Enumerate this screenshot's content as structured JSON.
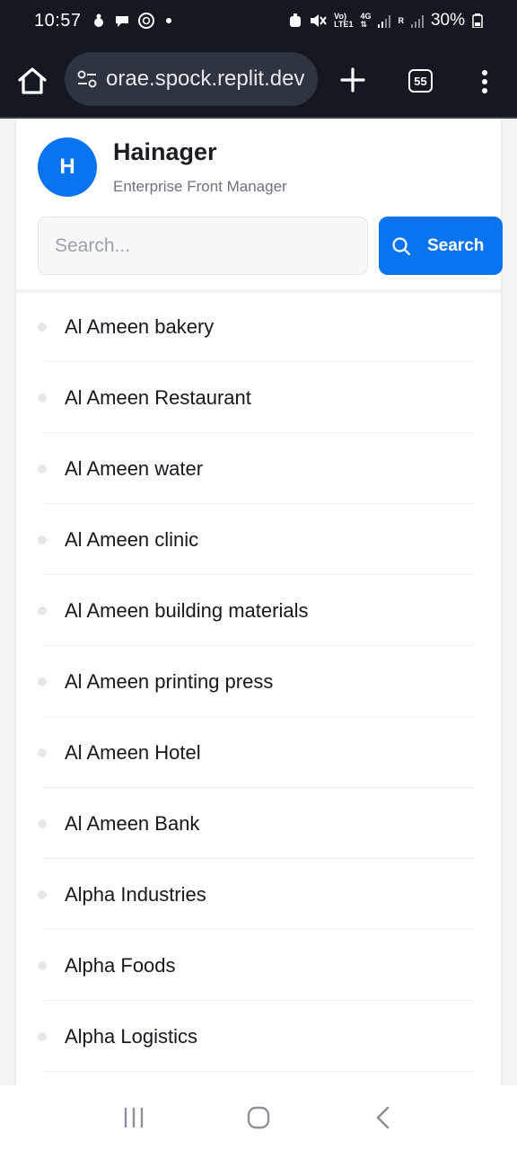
{
  "status_bar": {
    "time": "10:57",
    "battery_percent": "30%",
    "network_label": "4G",
    "volte_label": "Vo)",
    "lte_label": "LTE1",
    "roaming_label": "R",
    "icons": [
      "sleep-icon",
      "chat-icon",
      "openai-icon",
      "mute-icon",
      "signal-icon",
      "battery-icon"
    ]
  },
  "browser": {
    "url": "orae.spock.replit.dev",
    "tab_count": "55"
  },
  "app": {
    "avatar_letter": "H",
    "name": "Hainager",
    "subtitle": "Enterprise Front Manager"
  },
  "search": {
    "placeholder": "Search...",
    "value": "",
    "button_label": "Search"
  },
  "items": [
    {
      "label": "Al Ameen bakery"
    },
    {
      "label": "Al Ameen Restaurant"
    },
    {
      "label": "Al Ameen water"
    },
    {
      "label": "Al Ameen clinic"
    },
    {
      "label": "Al Ameen building materials"
    },
    {
      "label": "Al Ameen printing press"
    },
    {
      "label": "Al Ameen Hotel"
    },
    {
      "label": "Al Ameen Bank"
    },
    {
      "label": "Alpha Industries"
    },
    {
      "label": "Alpha Foods"
    },
    {
      "label": "Alpha Logistics"
    }
  ],
  "colors": {
    "accent": "#0a74f0",
    "chrome": "#141820"
  }
}
